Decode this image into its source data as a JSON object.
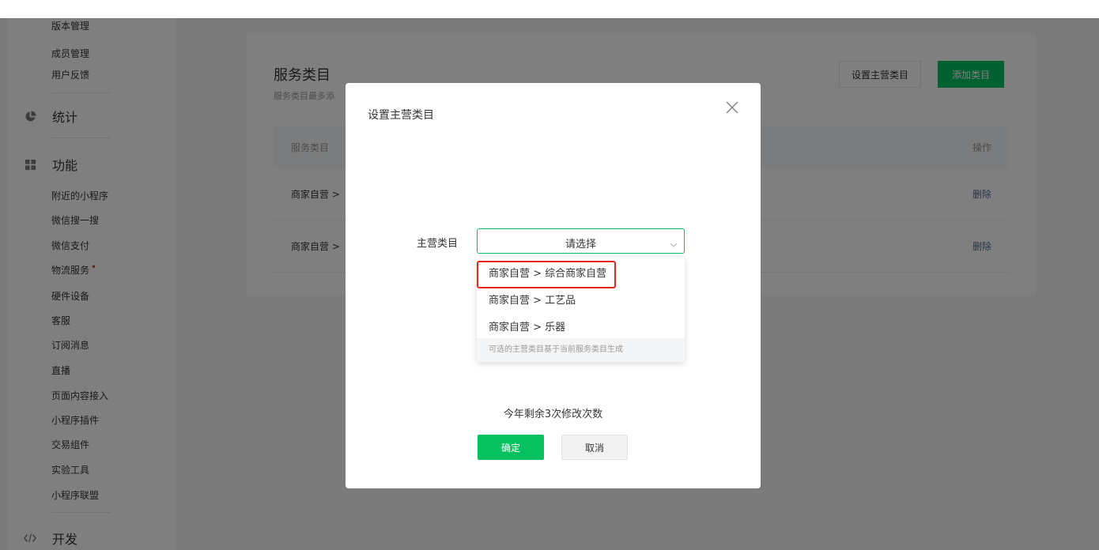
{
  "sidebar": {
    "top_items": [
      {
        "label": "版本管理"
      },
      {
        "label": "成员管理"
      },
      {
        "label": "用户反馈"
      }
    ],
    "stats_group": {
      "label": "统计",
      "icon": "pie-chart-icon"
    },
    "feature_group": {
      "label": "功能",
      "icon": "grid-icon"
    },
    "feature_items": [
      {
        "label": "附近的小程序"
      },
      {
        "label": "微信搜一搜"
      },
      {
        "label": "微信支付"
      },
      {
        "label": "物流服务",
        "badge_dot": "•"
      },
      {
        "label": "硬件设备"
      },
      {
        "label": "客服"
      },
      {
        "label": "订阅消息"
      },
      {
        "label": "直播"
      },
      {
        "label": "页面内容接入"
      },
      {
        "label": "小程序插件"
      },
      {
        "label": "交易组件"
      },
      {
        "label": "实验工具"
      },
      {
        "label": "小程序联盟"
      }
    ],
    "dev_group": {
      "label": "开发",
      "icon": "code-icon"
    }
  },
  "main": {
    "title": "服务类目",
    "description": "服务类目最多添",
    "set_main_button": "设置主营类目",
    "add_button": "添加类目",
    "table": {
      "header_left": "服务类目",
      "header_right": "操作",
      "rows": [
        {
          "category": "商家自营 >",
          "action": "删除"
        },
        {
          "category": "商家自营 >",
          "action": "删除"
        }
      ]
    }
  },
  "dialog": {
    "title": "设置主营类目",
    "field_label": "主营类目",
    "select_placeholder": "请选择",
    "options": [
      {
        "label": "商家自营 > 综合商家自营"
      },
      {
        "label": "商家自营 > 工艺品"
      },
      {
        "label": "商家自营 > 乐器"
      }
    ],
    "hint": "可选的主营类目基于当前服务类目生成",
    "remaining_text": "今年剩余3次修改次数",
    "ok_label": "确定",
    "cancel_label": "取消"
  },
  "colors": {
    "brand_green": "#07c160",
    "highlight_red": "#e8261f",
    "link_blue": "#576b95"
  }
}
